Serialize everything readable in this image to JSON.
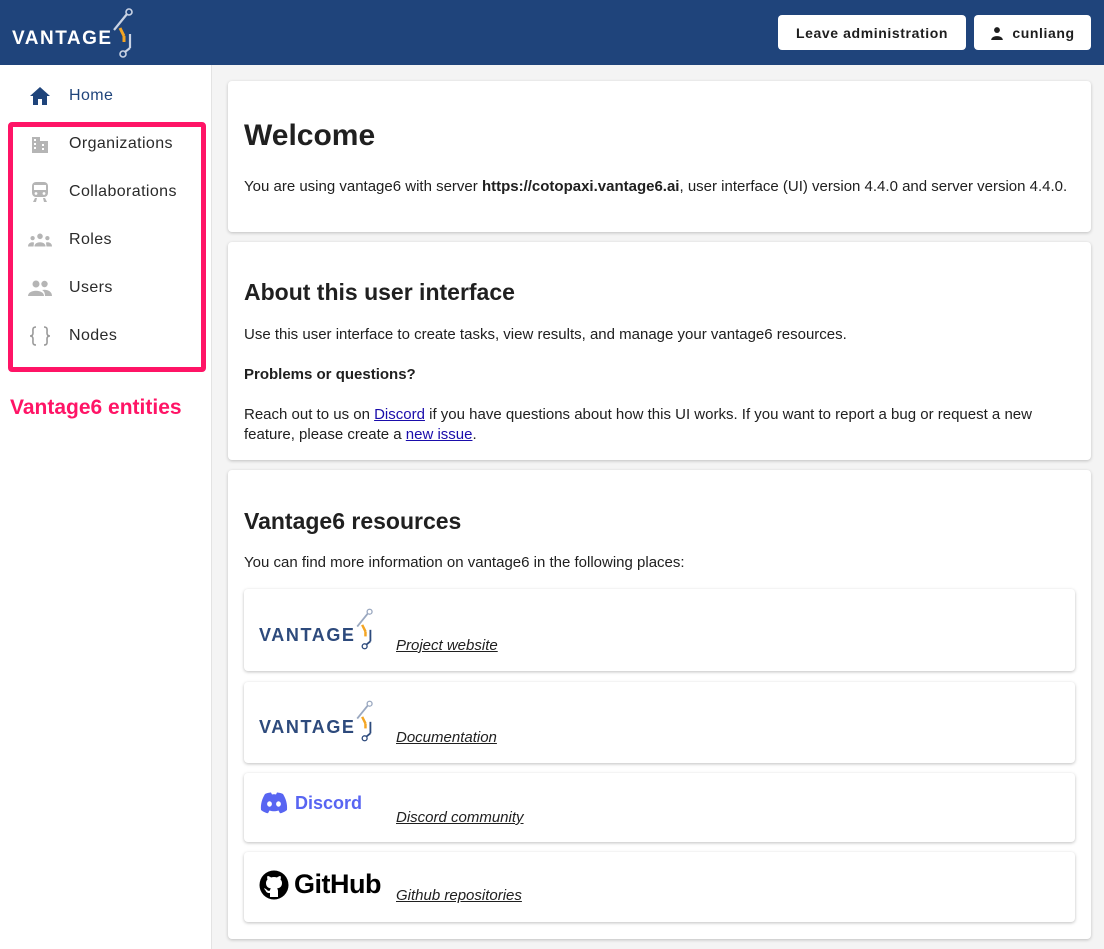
{
  "header": {
    "logo_text": "VANTAGE",
    "leave_button": "Leave administration",
    "user_button": "cunliang"
  },
  "sidebar": {
    "items": [
      {
        "label": "Home",
        "icon": "home-icon",
        "active": true
      },
      {
        "label": "Organizations",
        "icon": "building-icon"
      },
      {
        "label": "Collaborations",
        "icon": "train-icon"
      },
      {
        "label": "Roles",
        "icon": "groups-icon"
      },
      {
        "label": "Users",
        "icon": "people-icon"
      },
      {
        "label": "Nodes",
        "icon": "braces-icon"
      }
    ],
    "annotation": "Vantage6 entities",
    "annotation_color": "#ff1466"
  },
  "welcome": {
    "title": "Welcome",
    "text_prefix": "You are using vantage6 with server ",
    "server": "https://cotopaxi.vantage6.ai",
    "text_mid": ", user interface (UI) version 4.4.0 and server version 4.4.0."
  },
  "about": {
    "title": "About this user interface",
    "intro": "Use this user interface to create tasks, view results, and manage your vantage6 resources.",
    "problems_heading": "Problems or questions?",
    "reach_prefix": "Reach out to us on ",
    "discord_link": "Discord",
    "reach_mid": " if you have questions about how this UI works. If you want to report a bug or request a new feature, please create a ",
    "issue_link": "new issue",
    "reach_suffix": "."
  },
  "resources": {
    "title": "Vantage6 resources",
    "intro": "You can find more information on vantage6 in the following places:",
    "items": [
      {
        "logo": "VANTAGE",
        "link": "Project website"
      },
      {
        "logo": "VANTAGE",
        "link": "Documentation"
      },
      {
        "logo": "Discord",
        "link": "Discord community"
      },
      {
        "logo": "GitHub",
        "link": "Github repositories"
      }
    ]
  },
  "colors": {
    "header": "#1f447b",
    "accent_orange": "#f4a523",
    "link": "#1a0dab"
  }
}
